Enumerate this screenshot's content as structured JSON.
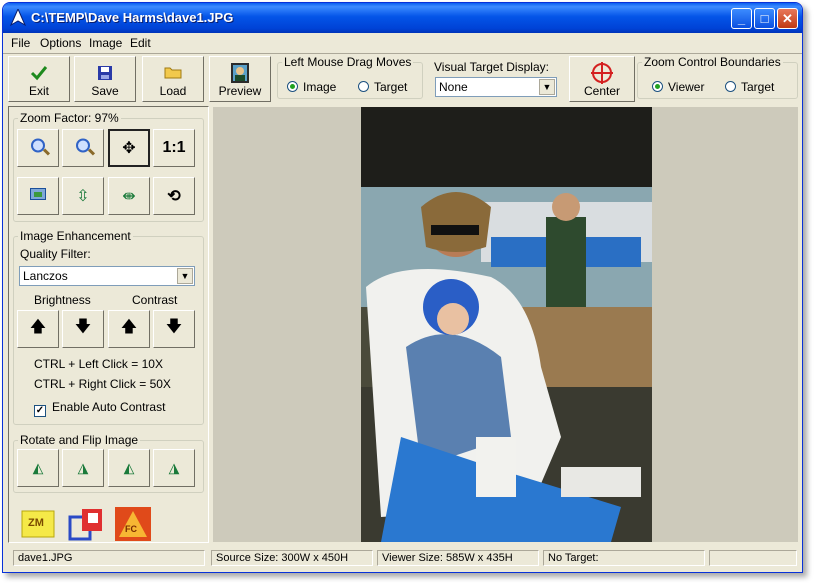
{
  "window": {
    "title": "C:\\TEMP\\Dave Harms\\dave1.JPG"
  },
  "menu": [
    "File",
    "Options",
    "Image",
    "Edit"
  ],
  "toolbar": {
    "exit": "Exit",
    "save": "Save",
    "load": "Load",
    "preview": "Preview",
    "center": "Center"
  },
  "drag_group": {
    "legend": "Left Mouse Drag Moves",
    "options": [
      "Image",
      "Target"
    ],
    "selected": "Image"
  },
  "visual_target": {
    "label": "Visual Target Display:",
    "value": "None"
  },
  "zoom_boundaries": {
    "legend": "Zoom Control Boundaries",
    "options": [
      "Viewer",
      "Target"
    ],
    "selected": "Viewer"
  },
  "zoom": {
    "legend": "Zoom Factor: 97%",
    "one_to_one": "1:1"
  },
  "enhancement": {
    "legend": "Image Enhancement",
    "quality_label": "Quality Filter:",
    "quality_value": "Lanczos",
    "brightness": "Brightness",
    "contrast": "Contrast",
    "hint_left": "CTRL + Left Click = 10X",
    "hint_right": "CTRL + Right Click = 50X",
    "auto_contrast": "Enable Auto Contrast",
    "auto_contrast_checked": true
  },
  "rotate": {
    "legend": "Rotate and Flip Image"
  },
  "bottom_icons": {
    "zm": "ZM",
    "fc": "FC"
  },
  "status": {
    "file": "dave1.JPG",
    "source_size": "Source Size: 300W x 450H",
    "viewer_size": "Viewer Size: 585W x 435H",
    "target": "No Target:",
    "extra": ""
  }
}
